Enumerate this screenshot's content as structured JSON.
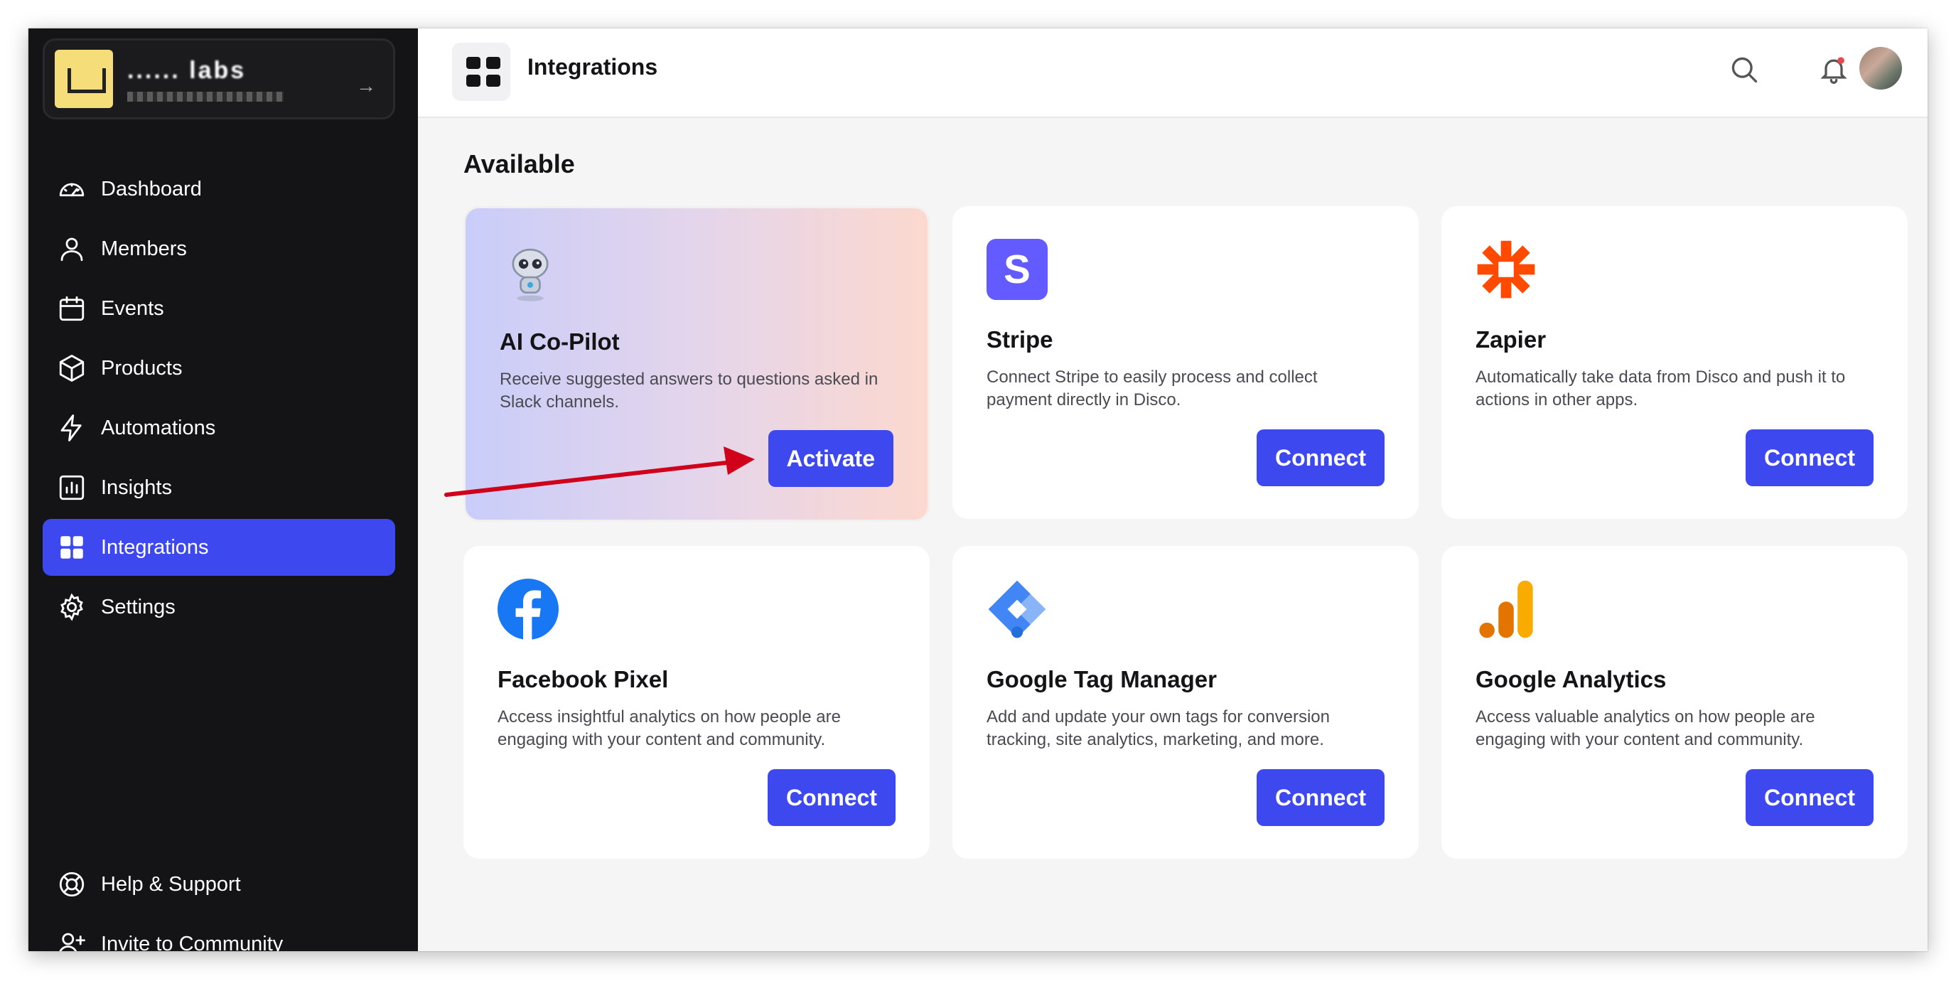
{
  "org": {
    "name": "...... labs",
    "switch_icon": "switch-icon"
  },
  "sidebar": {
    "items": [
      {
        "label": "Dashboard",
        "icon": "dashboard-icon"
      },
      {
        "label": "Members",
        "icon": "person-icon"
      },
      {
        "label": "Events",
        "icon": "calendar-icon"
      },
      {
        "label": "Products",
        "icon": "box-icon"
      },
      {
        "label": "Automations",
        "icon": "bolt-icon"
      },
      {
        "label": "Insights",
        "icon": "chart-icon"
      },
      {
        "label": "Integrations",
        "icon": "grid-icon",
        "active": true
      },
      {
        "label": "Settings",
        "icon": "gear-icon"
      }
    ],
    "bottom_items": [
      {
        "label": "Help & Support",
        "icon": "lifebuoy-icon"
      },
      {
        "label": "Invite to Community",
        "icon": "add-person-icon"
      }
    ]
  },
  "header": {
    "title": "Integrations"
  },
  "main": {
    "section_title": "Available",
    "cards": [
      {
        "title": "AI Co-Pilot",
        "description": "Receive suggested answers to questions asked in Slack channels.",
        "button": "Activate",
        "logo": "robot-icon"
      },
      {
        "title": "Stripe",
        "description": "Connect Stripe to easily process and collect payment directly in Disco.",
        "button": "Connect",
        "logo": "stripe-icon"
      },
      {
        "title": "Zapier",
        "description": "Automatically take data from Disco and push it to actions in other apps.",
        "button": "Connect",
        "logo": "zapier-icon"
      },
      {
        "title": "Facebook Pixel",
        "description": "Access insightful analytics on how people are engaging with your content and community.",
        "button": "Connect",
        "logo": "facebook-icon"
      },
      {
        "title": "Google Tag Manager",
        "description": "Add and update your own tags for conversion tracking, site analytics, marketing, and more.",
        "button": "Connect",
        "logo": "google-tag-manager-icon"
      },
      {
        "title": "Google Analytics",
        "description": "Access valuable analytics on how people are engaging with your content and community.",
        "button": "Connect",
        "logo": "google-analytics-icon"
      }
    ]
  },
  "colors": {
    "accent": "#3d48ee",
    "sidebar_bg": "#141416",
    "arrow": "#d0021b",
    "zapier": "#ff4a00",
    "stripe": "#635bff",
    "facebook": "#1877f2"
  }
}
